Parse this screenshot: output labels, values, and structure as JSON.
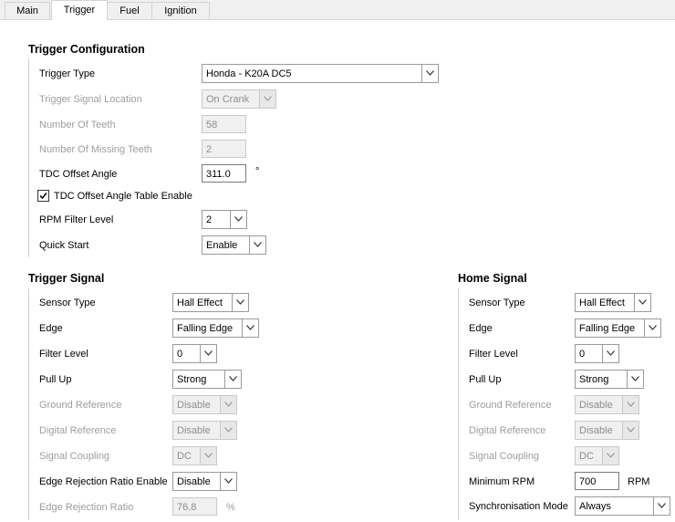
{
  "tabs": [
    {
      "label": "Main"
    },
    {
      "label": "Trigger"
    },
    {
      "label": "Fuel"
    },
    {
      "label": "Ignition"
    }
  ],
  "trigger_config": {
    "title": "Trigger Configuration",
    "trigger_type": {
      "label": "Trigger Type",
      "value": "Honda - K20A DC5"
    },
    "signal_location": {
      "label": "Trigger Signal Location",
      "value": "On Crank"
    },
    "num_teeth": {
      "label": "Number Of Teeth",
      "value": "58"
    },
    "missing_teeth": {
      "label": "Number Of Missing Teeth",
      "value": "2"
    },
    "tdc_offset": {
      "label": "TDC Offset Angle",
      "value": "311.0",
      "unit": "°"
    },
    "tdc_table_enable": {
      "label": "TDC Offset Angle Table Enable",
      "checked": true
    },
    "rpm_filter": {
      "label": "RPM Filter Level",
      "value": "2"
    },
    "quick_start": {
      "label": "Quick Start",
      "value": "Enable"
    }
  },
  "trigger_signal": {
    "title": "Trigger Signal",
    "sensor_type": {
      "label": "Sensor Type",
      "value": "Hall Effect"
    },
    "edge": {
      "label": "Edge",
      "value": "Falling Edge"
    },
    "filter_level": {
      "label": "Filter Level",
      "value": "0"
    },
    "pull_up": {
      "label": "Pull Up",
      "value": "Strong"
    },
    "ground_ref": {
      "label": "Ground Reference",
      "value": "Disable"
    },
    "digital_ref": {
      "label": "Digital Reference",
      "value": "Disable"
    },
    "coupling": {
      "label": "Signal Coupling",
      "value": "DC"
    },
    "edge_rej_enable": {
      "label": "Edge Rejection Ratio Enable",
      "value": "Disable"
    },
    "edge_rej_ratio": {
      "label": "Edge Rejection Ratio",
      "value": "76.8",
      "unit": "%"
    }
  },
  "home_signal": {
    "title": "Home Signal",
    "sensor_type": {
      "label": "Sensor Type",
      "value": "Hall Effect"
    },
    "edge": {
      "label": "Edge",
      "value": "Falling Edge"
    },
    "filter_level": {
      "label": "Filter Level",
      "value": "0"
    },
    "pull_up": {
      "label": "Pull Up",
      "value": "Strong"
    },
    "ground_ref": {
      "label": "Ground Reference",
      "value": "Disable"
    },
    "digital_ref": {
      "label": "Digital Reference",
      "value": "Disable"
    },
    "coupling": {
      "label": "Signal Coupling",
      "value": "DC"
    },
    "min_rpm": {
      "label": "Minimum RPM",
      "value": "700",
      "unit": "RPM"
    },
    "sync_mode": {
      "label": "Synchronisation Mode",
      "value": "Always"
    }
  }
}
